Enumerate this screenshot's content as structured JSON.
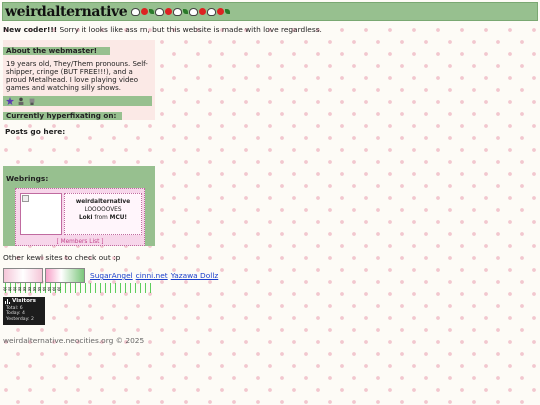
{
  "header": {
    "title": "weirdalternative",
    "decorations": [
      "cat-icon",
      "apple-icon",
      "leaf-icon",
      "cat-icon",
      "apple-icon",
      "cat-icon",
      "leaf-icon",
      "cat-icon",
      "apple-icon",
      "cat-icon",
      "apple-icon",
      "leaf-icon"
    ]
  },
  "intro": {
    "bold": "New coder!!!",
    "text": " Sorry it looks like ass rn, but this website is made with love regardless."
  },
  "about": {
    "heading": "About the webmaster!",
    "bio": "19 years old, They/Them pronouns. Self-shipper, cringe (BUT FREE!!!), and a proud Metalhead. I love playing video games and watching silly shows.",
    "hyperfix_heading": "Currently hyperfixating on:",
    "icons": [
      "star-icon",
      "person-icon",
      "robot-icon"
    ]
  },
  "posts": {
    "heading": "Posts go here:"
  },
  "webrings": {
    "heading": "Webrings:",
    "ring_title": "weirdalternative",
    "ring_line1": "LOOOOOVES",
    "ring_name": "Loki",
    "ring_from": "from",
    "ring_fandom": "MCU!",
    "members": "[ Members List ]"
  },
  "other": {
    "text": "Other kewl sites to check out :p",
    "links": [
      "SugarAngel",
      "cinni.net",
      "Yazawa Dollz"
    ]
  },
  "marquee": {
    "text": "ʬʬʬʬʬʬʬʬʬʬʬʬ"
  },
  "visitors": {
    "title": "Visitors",
    "total": "Total: 6",
    "today": "Today: 4",
    "yesterday": "Yesterday: 2"
  },
  "footer": {
    "text": "weirdalternative.neocities.org © 2025"
  },
  "colors": {
    "green": "#97c08f",
    "pink_panel": "#fbe9e6",
    "link": "#1a3fcc"
  }
}
